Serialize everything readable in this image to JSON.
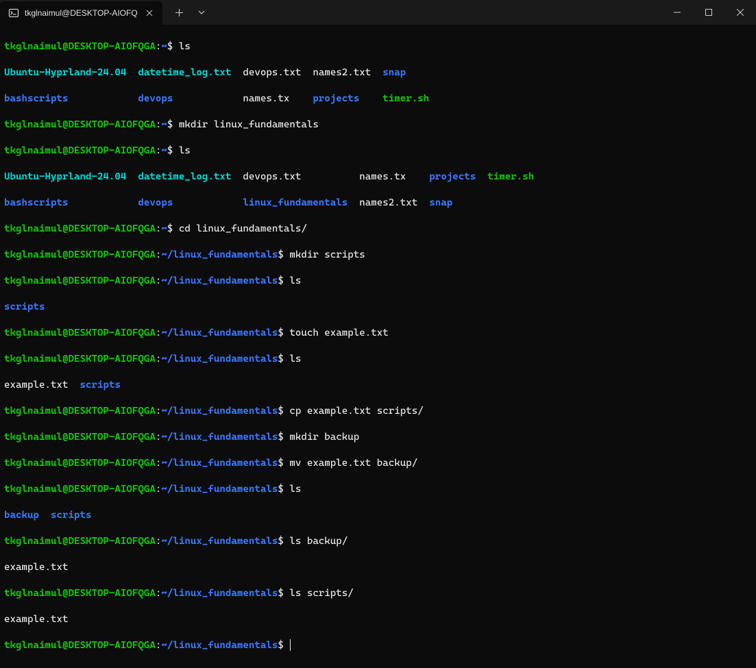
{
  "titlebar": {
    "tab_title": "tkglnaimul@DESKTOP-AIOFQ"
  },
  "prompt": {
    "user_host": "tkglnaimul@DESKTOP-AIOFQGA",
    "sep": ":",
    "home": "~",
    "path_lf": "~/linux_fundamentals",
    "dollar": "$"
  },
  "cmds": {
    "ls": "ls",
    "mkdir_lf": "mkdir linux_fundamentals",
    "cd_lf": "cd linux_fundamentals/",
    "mkdir_scripts": "mkdir scripts",
    "touch_example": "touch example.txt",
    "cp_example": "cp example.txt scripts/",
    "mkdir_backup": "mkdir backup",
    "mv_example": "mv example.txt backup/",
    "ls_backup": "ls backup/",
    "ls_scripts": "ls scripts/"
  },
  "ls1": {
    "line1": {
      "ubuntu": "Ubuntu-Hyprland-24.04",
      "datetime": "datetime_log.txt",
      "devops_txt": "devops.txt",
      "names2": "names2.txt",
      "snap": "snap"
    },
    "line2": {
      "bashscripts": "bashscripts",
      "devops": "devops",
      "names_tx": "names.tx",
      "projects": "projects",
      "timer": "timer.sh"
    }
  },
  "ls2": {
    "line1": {
      "ubuntu": "Ubuntu-Hyprland-24.04",
      "datetime": "datetime_log.txt",
      "devops_txt": "devops.txt",
      "names_tx": "names.tx",
      "projects": "projects",
      "timer": "timer.sh"
    },
    "line2": {
      "bashscripts": "bashscripts",
      "devops": "devops",
      "linux_fund": "linux_fundamentals",
      "names2": "names2.txt",
      "snap": "snap"
    }
  },
  "out": {
    "scripts": "scripts",
    "example_txt": "example.txt",
    "backup": "backup"
  }
}
